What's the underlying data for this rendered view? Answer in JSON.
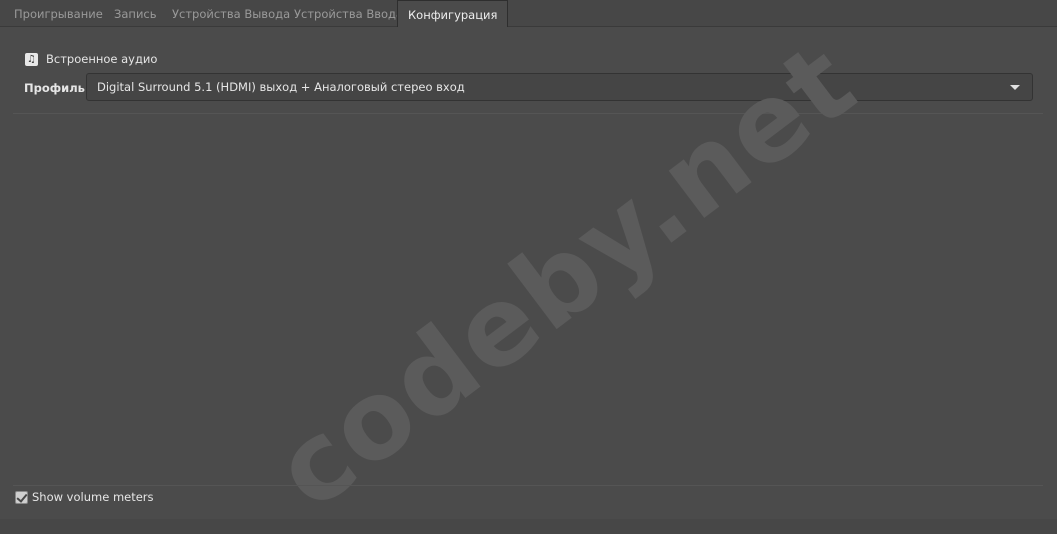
{
  "tabs": [
    {
      "label": "Проигрывание",
      "active": false
    },
    {
      "label": "Запись",
      "active": false
    },
    {
      "label": "Устройства Вывода",
      "active": false
    },
    {
      "label": "Устройства Ввода",
      "active": false
    },
    {
      "label": "Конфигурация",
      "active": true
    }
  ],
  "device": {
    "icon": "music-note-icon",
    "name": "Встроенное аудио"
  },
  "profile": {
    "label": "Профиль:",
    "selected": "Digital Surround 5.1 (HDMI) выход + Аналоговый стерео вход"
  },
  "watermark": "codeby.net",
  "footer": {
    "show_volume_meters_label": "Show volume meters",
    "show_volume_meters_checked": true
  },
  "colors": {
    "background": "#474747",
    "panel": "#4b4b4b",
    "text": "#e6e6e6",
    "inactive_tab_text": "#9a9a9a",
    "watermark": "#5b5b5b"
  }
}
